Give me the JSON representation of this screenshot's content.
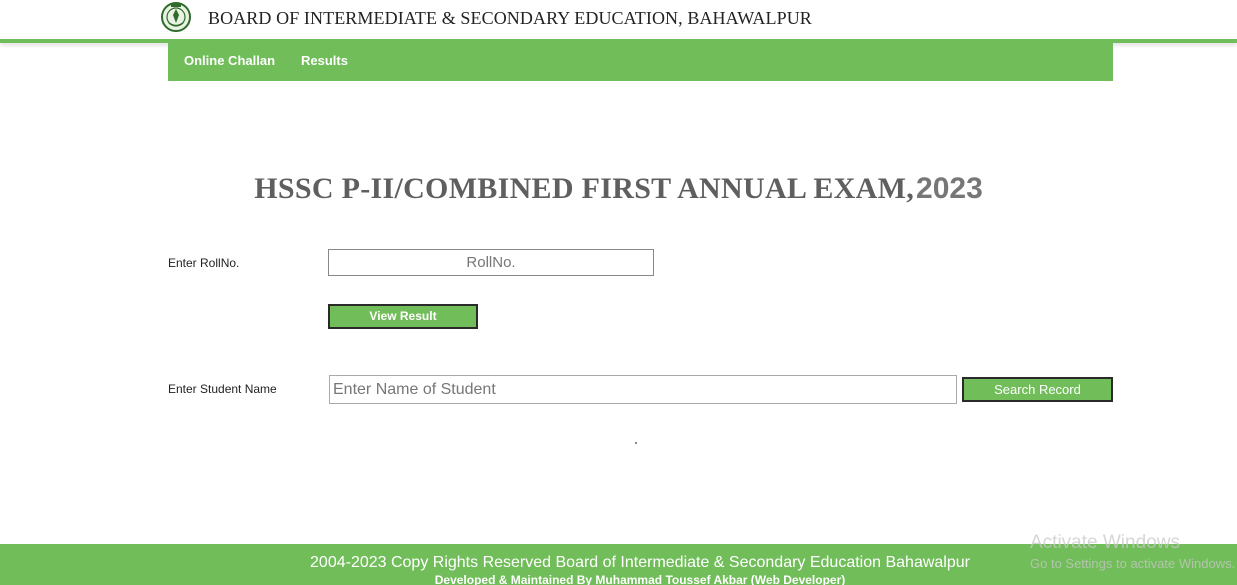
{
  "header": {
    "board_title": "BOARD OF INTERMEDIATE & SECONDARY EDUCATION, BAHAWALPUR",
    "logo_icon": "board-crest-logo"
  },
  "nav": {
    "items": [
      {
        "label": "Online Challan"
      },
      {
        "label": "Results"
      }
    ]
  },
  "exam": {
    "title": "HSSC P-II/COMBINED FIRST ANNUAL EXAM,",
    "year": "2023"
  },
  "form": {
    "roll_label": "Enter RollNo.",
    "roll_placeholder": "RollNo.",
    "roll_value": "",
    "view_button": "View Result",
    "name_label": "Enter Student Name",
    "name_placeholder": "Enter Name of Student",
    "name_value": "",
    "search_button": "Search Record"
  },
  "footer": {
    "copyright": "2004-2023 Copy Rights Reserved Board of Intermediate & Secondary Education Bahawalpur",
    "developer": "Developed & Maintained By Muhammad Toussef Akbar (Web Developer)"
  },
  "watermark": {
    "line1": "Activate Windows",
    "line2": "Go to Settings to activate Windows."
  },
  "colors": {
    "accent": "#71bd5a",
    "title_gray": "#5f5f5f"
  }
}
